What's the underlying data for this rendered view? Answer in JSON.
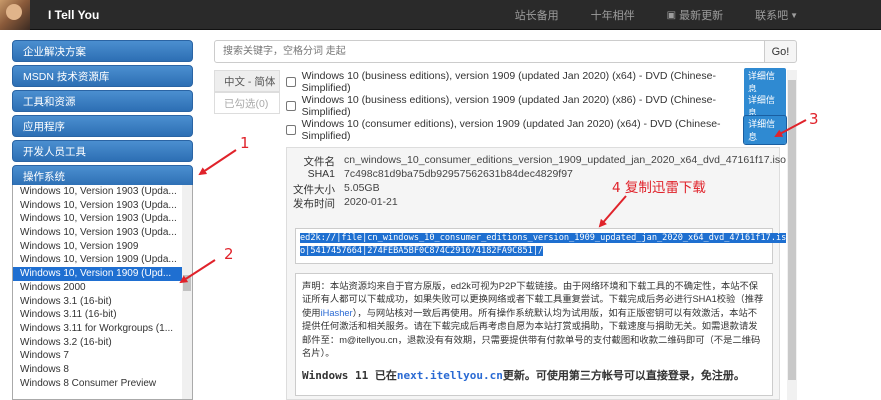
{
  "navbar": {
    "brand": "I Tell You",
    "links": [
      {
        "label": "站长备用",
        "icon": ""
      },
      {
        "label": "十年相伴",
        "icon": ""
      },
      {
        "label": "最新更新",
        "icon": "new-icon"
      },
      {
        "label": "联系吧",
        "icon": ""
      }
    ]
  },
  "sidebar": {
    "items": [
      {
        "label": "企业解决方案"
      },
      {
        "label": "MSDN 技术资源库"
      },
      {
        "label": "工具和资源"
      },
      {
        "label": "应用程序"
      },
      {
        "label": "开发人员工具"
      },
      {
        "label": "操作系统"
      }
    ],
    "sub_items": [
      "Windows 10, Version 1903 (Upda...",
      "Windows 10, Version 1903 (Upda...",
      "Windows 10, Version 1903 (Upda...",
      "Windows 10, Version 1903 (Upda...",
      "Windows 10, Version 1909",
      "Windows 10, Version 1909 (Upda...",
      "Windows 10, Version 1909 (Upd...",
      "Windows 2000",
      "Windows 3.1 (16-bit)",
      "Windows 3.11 (16-bit)",
      "Windows 3.11 for Workgroups (1...",
      "Windows 3.2 (16-bit)",
      "Windows 7",
      "Windows 8",
      "Windows 8 Consumer Preview"
    ],
    "selected_index": 6
  },
  "search": {
    "placeholder": "搜索关键字，空格分词 走起",
    "button": "Go!"
  },
  "tabs": [
    {
      "label": "中文 - 简体"
    },
    {
      "label": "已勾选(0)"
    }
  ],
  "downloads": [
    {
      "label": "Windows 10 (business editions), version 1909 (updated Jan 2020) (x64) - DVD (Chinese-Simplified)",
      "badge": "详细信息"
    },
    {
      "label": "Windows 10 (business editions), version 1909 (updated Jan 2020) (x86) - DVD (Chinese-Simplified)",
      "badge": "详细信息"
    },
    {
      "label": "Windows 10 (consumer editions), version 1909 (updated Jan 2020) (x64) - DVD (Chinese-Simplified)",
      "badge": "详细信息"
    }
  ],
  "details": {
    "filename_label": "文件名",
    "filename": "cn_windows_10_consumer_editions_version_1909_updated_jan_2020_x64_dvd_47161f17.iso",
    "sha1_label": "SHA1",
    "sha1": "7c498c81d9ba75db92957562631b84dec4829f97",
    "size_label": "文件大小",
    "size": "5.05GB",
    "date_label": "发布时间",
    "date": "2020-01-21",
    "ed2k_line1": "ed2k://|file|cn_windows_10_consumer_editions_version_1909_updated_jan_2020_x64_dvd_47161f17.is",
    "ed2k_line2": "o|5417457664|274FEBA5BF0C874C291674182FA9C851|/"
  },
  "notice": {
    "p1": "声明：本站资源均来自于官方原版，ed2k可视为P2P下载链接。由于网络环境和下载工具的不确定性，本站不保证所有人都可以下载成功，如果失败可以更换网络或者下载工具重复尝试。下载完成后务必进行SHA1校验（推荐使用",
    "p1_link": "iHasher",
    "p2": "），与网站核对一致后再使用。所有操作系统默认均为试用版，如有正版密钥可以有效激活，本站不提供任何激活和相关服务。请在下载完成后再考虑自愿为本站打赏或捐助，下载速度与捐助无关。如需退款请发邮件至：m@itellyou.cn，退款没有有效期，只需要提供带有付款单号的支付截图和收款二维码即可（不是二维码名片）。",
    "win11_pre": "Windows 11 已在",
    "win11_link": "next.itellyou.cn",
    "win11_post": "更新。可使用第三方帐号可以直接登录，免注册。"
  },
  "annotations": {
    "n1": "1",
    "n2": "2",
    "n3": "3",
    "n4": "4 复制迅雷下载",
    "color": "#e0232b"
  }
}
